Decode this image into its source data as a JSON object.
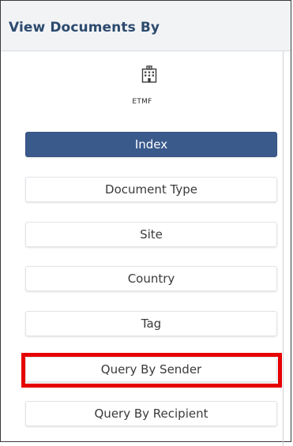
{
  "panel": {
    "title": "View Documents By",
    "module_label": "ETMF",
    "module_icon": "building-icon"
  },
  "nav": {
    "items": [
      {
        "label": "Index",
        "active": true
      },
      {
        "label": "Document Type",
        "active": false
      },
      {
        "label": "Site",
        "active": false
      },
      {
        "label": "Country",
        "active": false
      },
      {
        "label": "Tag",
        "active": false
      },
      {
        "label": "Query By Sender",
        "active": false,
        "highlighted": true
      },
      {
        "label": "Query By Recipient",
        "active": false
      }
    ]
  },
  "colors": {
    "title": "#2c4a6e",
    "active_button": "#3a5a8c",
    "highlight": "#e60000"
  }
}
